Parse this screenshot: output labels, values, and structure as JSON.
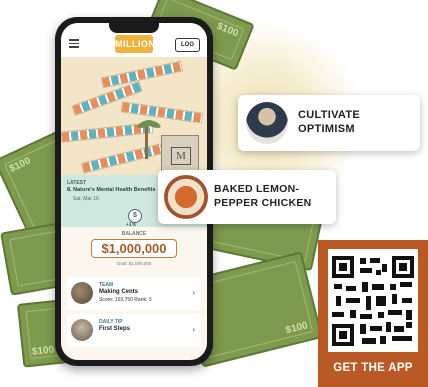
{
  "app": {
    "logo_text": "MILLION",
    "log_button": "LOG"
  },
  "latest": {
    "label": "LATEST",
    "title": "8. Nature's Mental Health Benefits",
    "date": "Sat, Mar 16",
    "coin": "$",
    "change": "+1%"
  },
  "balance": {
    "label": "BALANCE",
    "amount": "$1,000,000",
    "goal": "Goal: $1,000,000"
  },
  "cards": [
    {
      "tag": "TEAM",
      "title": "Making Cents",
      "detail": "Score: 103,750    Rank: 3"
    },
    {
      "tag": "DAILY TIP",
      "title": "First Steps",
      "detail": ""
    }
  ],
  "bills": [
    "$100",
    "$100",
    "$100",
    "$100",
    "$100"
  ],
  "callouts": [
    {
      "line1": "CULTIVATE",
      "line2": "OPTIMISM"
    },
    {
      "line1": "BAKED LEMON-",
      "line2": "PEPPER CHICKEN"
    }
  ],
  "qr": {
    "label": "GET THE APP"
  },
  "colors": {
    "accent_orange": "#b95a26",
    "money_green": "#7e9a4e",
    "teal": "#cfe8df"
  }
}
